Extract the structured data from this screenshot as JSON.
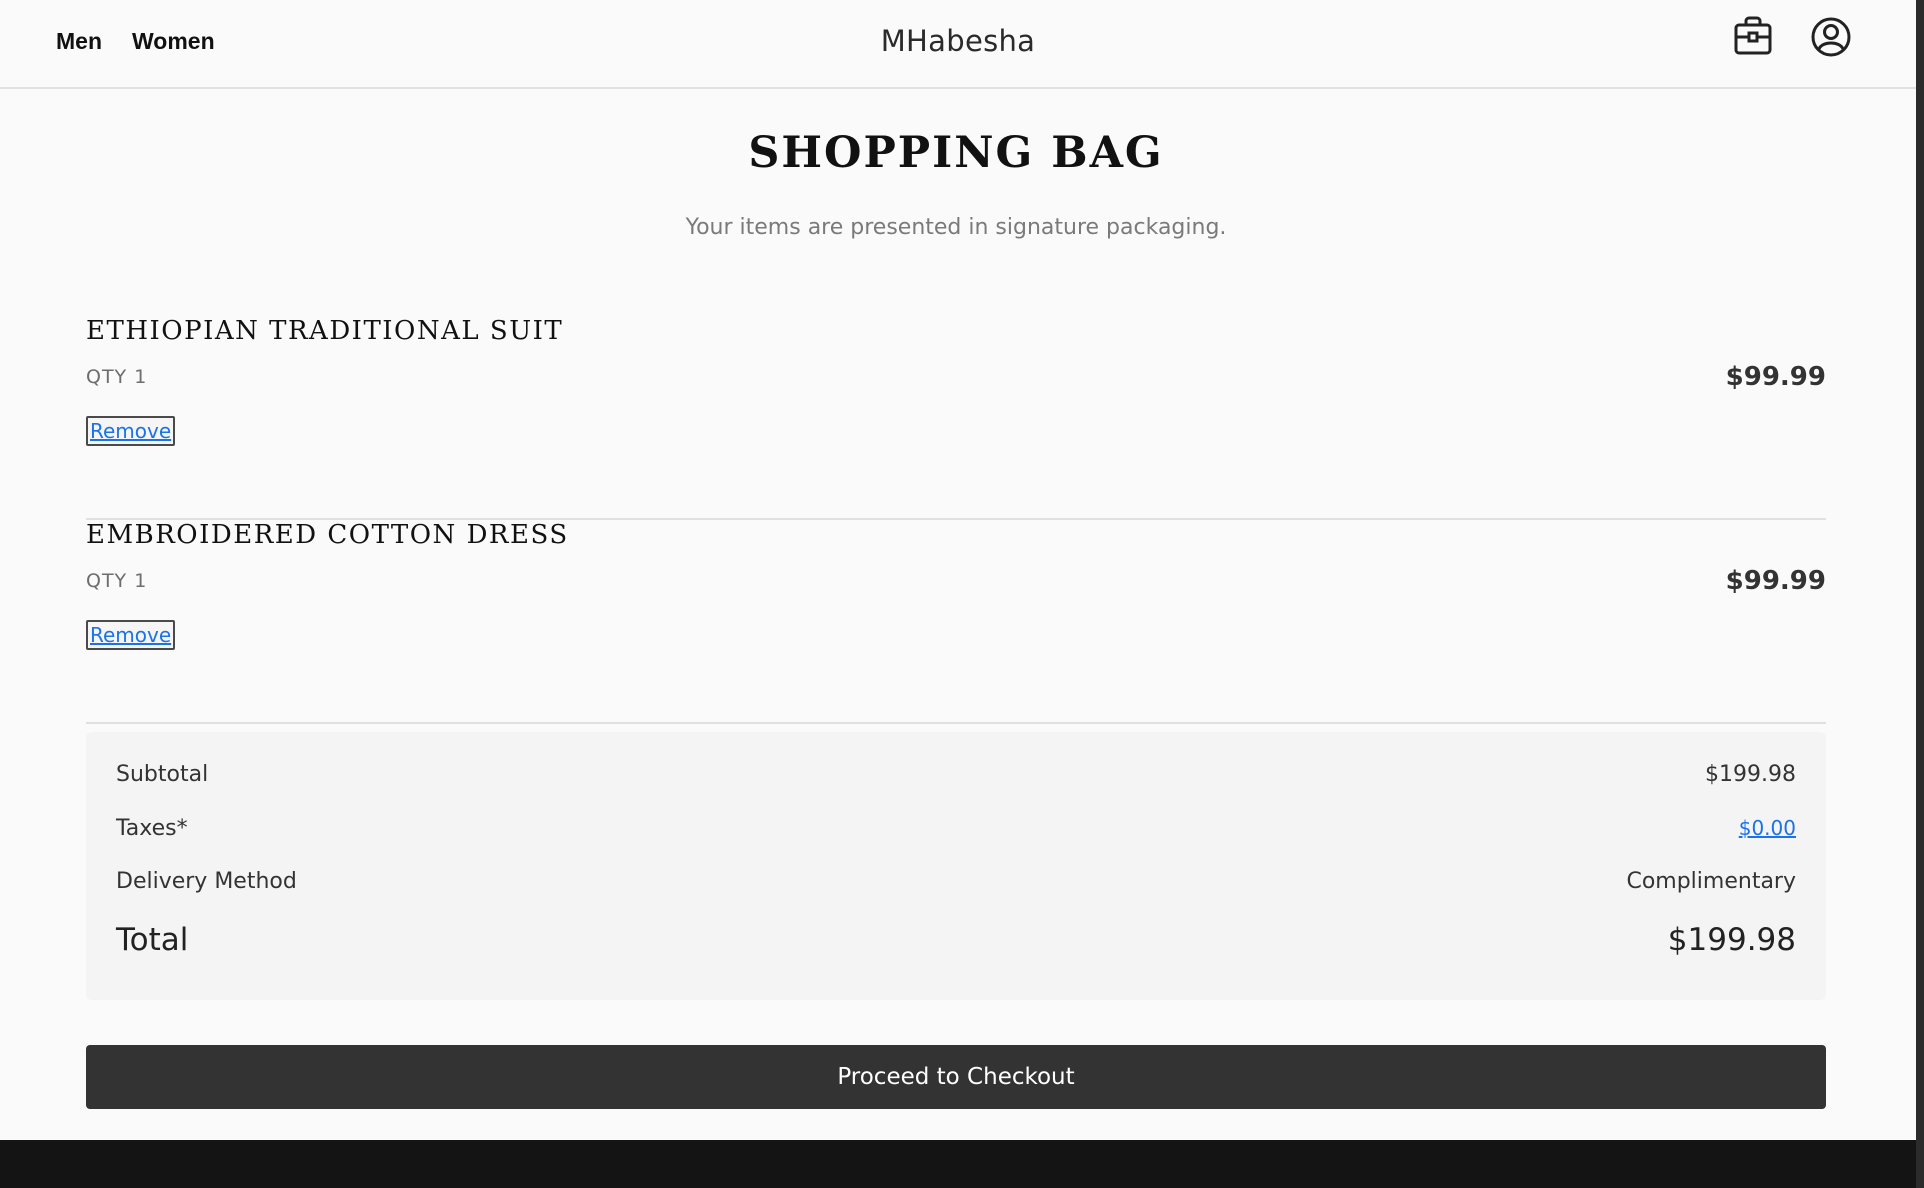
{
  "header": {
    "nav": [
      {
        "label": "Men"
      },
      {
        "label": "Women"
      }
    ],
    "brand": "MHabesha",
    "icons": [
      "shopping-bag-icon",
      "account-icon"
    ]
  },
  "main": {
    "title": "SHOPPING BAG",
    "subtitle": "Your items are presented in signature packaging.",
    "items": [
      {
        "name": "ETHIOPIAN TRADITIONAL SUIT",
        "qty": "QTY 1",
        "remove_label": "Remove",
        "price": "$99.99"
      },
      {
        "name": "EMBROIDERED COTTON DRESS",
        "qty": "QTY 1",
        "remove_label": "Remove",
        "price": "$99.99"
      }
    ]
  },
  "summary": {
    "subtotal_label": "Subtotal",
    "subtotal_value": "$199.98",
    "taxes_label": "Taxes*",
    "taxes_value": "$0.00",
    "delivery_label": "Delivery Method",
    "delivery_value": "Complimentary",
    "total_label": "Total",
    "total_value": "$199.98"
  },
  "checkout": {
    "label": "Proceed to Checkout"
  },
  "colors": {
    "background": "#fafafa",
    "button": "#333333",
    "link": "#1a73e8",
    "footer": "#141414"
  }
}
